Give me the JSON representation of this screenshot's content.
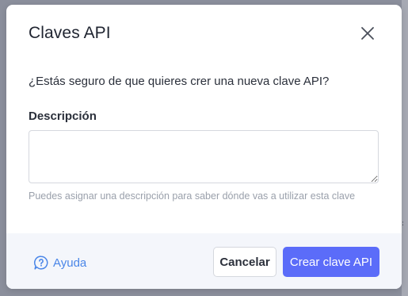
{
  "modal": {
    "title": "Claves API",
    "question": "¿Estás seguro de que quieres crer una nueva clave API?",
    "description_label": "Descripción",
    "description_value": "",
    "description_placeholder": "",
    "help_text": "Puedes asignar una descripción para saber dónde vas a utilizar esta clave"
  },
  "footer": {
    "help_label": "Ayuda",
    "cancel_label": "Cancelar",
    "create_label": "Crear clave API"
  },
  "icons": {
    "close": "close-icon",
    "help": "help-chat-icon"
  },
  "colors": {
    "primary": "#5b6cf9",
    "link": "#4a86e8",
    "footer_bg": "#f4f6fb",
    "backdrop": "#8b8f9c"
  }
}
